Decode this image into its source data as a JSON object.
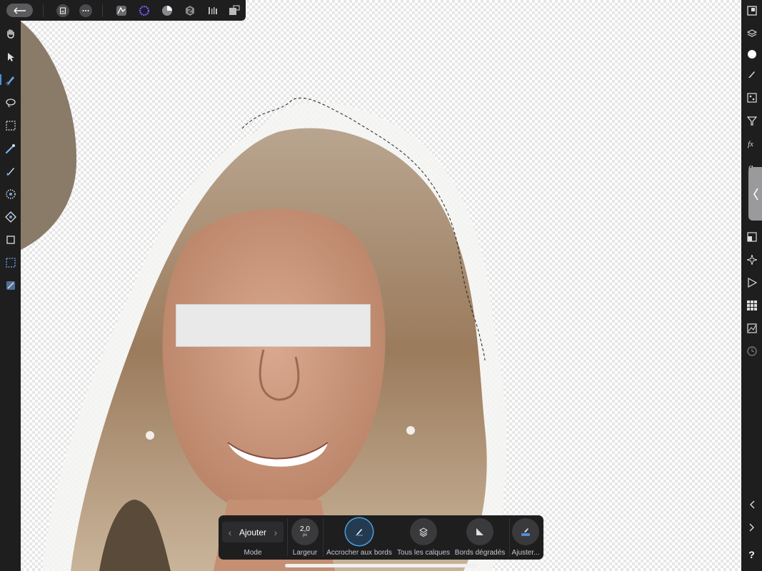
{
  "top_toolbar": {
    "icons": [
      "back-arrow-icon",
      "document-icon",
      "more-icon",
      "photo-persona-icon",
      "liquify-persona-icon",
      "develop-persona-icon",
      "tone-mapping-persona-icon",
      "export-persona-icon",
      "selection-persona-icon"
    ]
  },
  "left_toolbar": {
    "tools": [
      "view-tool-icon",
      "move-tool-icon",
      "selection-brush-icon",
      "freehand-selection-icon",
      "marquee-selection-icon",
      "color-picker-icon",
      "paint-brush-icon",
      "dodge-burn-icon",
      "clone-icon",
      "crop-icon",
      "rectangle-selection-icon",
      "flood-fill-icon"
    ]
  },
  "right_toolbar": {
    "studios": [
      "navigator-icon",
      "layers-icon",
      "color-icon",
      "brushes-icon",
      "channels-icon",
      "adjustments-icon",
      "fx-icon",
      "character-icon",
      "transform-icon",
      "effects-icon",
      "play-icon",
      "swatches-icon",
      "histogram-icon",
      "history-icon"
    ],
    "help_label": "?"
  },
  "context_toolbar": {
    "mode": {
      "value": "Ajouter",
      "label": "Mode"
    },
    "width": {
      "value": "2,0",
      "unit": "px",
      "label": "Largeur"
    },
    "snap": {
      "label": "Accrocher aux bords"
    },
    "all_layers": {
      "label": "Tous les calques"
    },
    "soft_edges": {
      "label": "Bords dégradés"
    },
    "refine": {
      "label": "Ajuster..."
    }
  },
  "colors": {
    "accent": "#4a9ee0",
    "ui_dark": "#1e1e1f",
    "redaction": "#e9e9e9"
  }
}
